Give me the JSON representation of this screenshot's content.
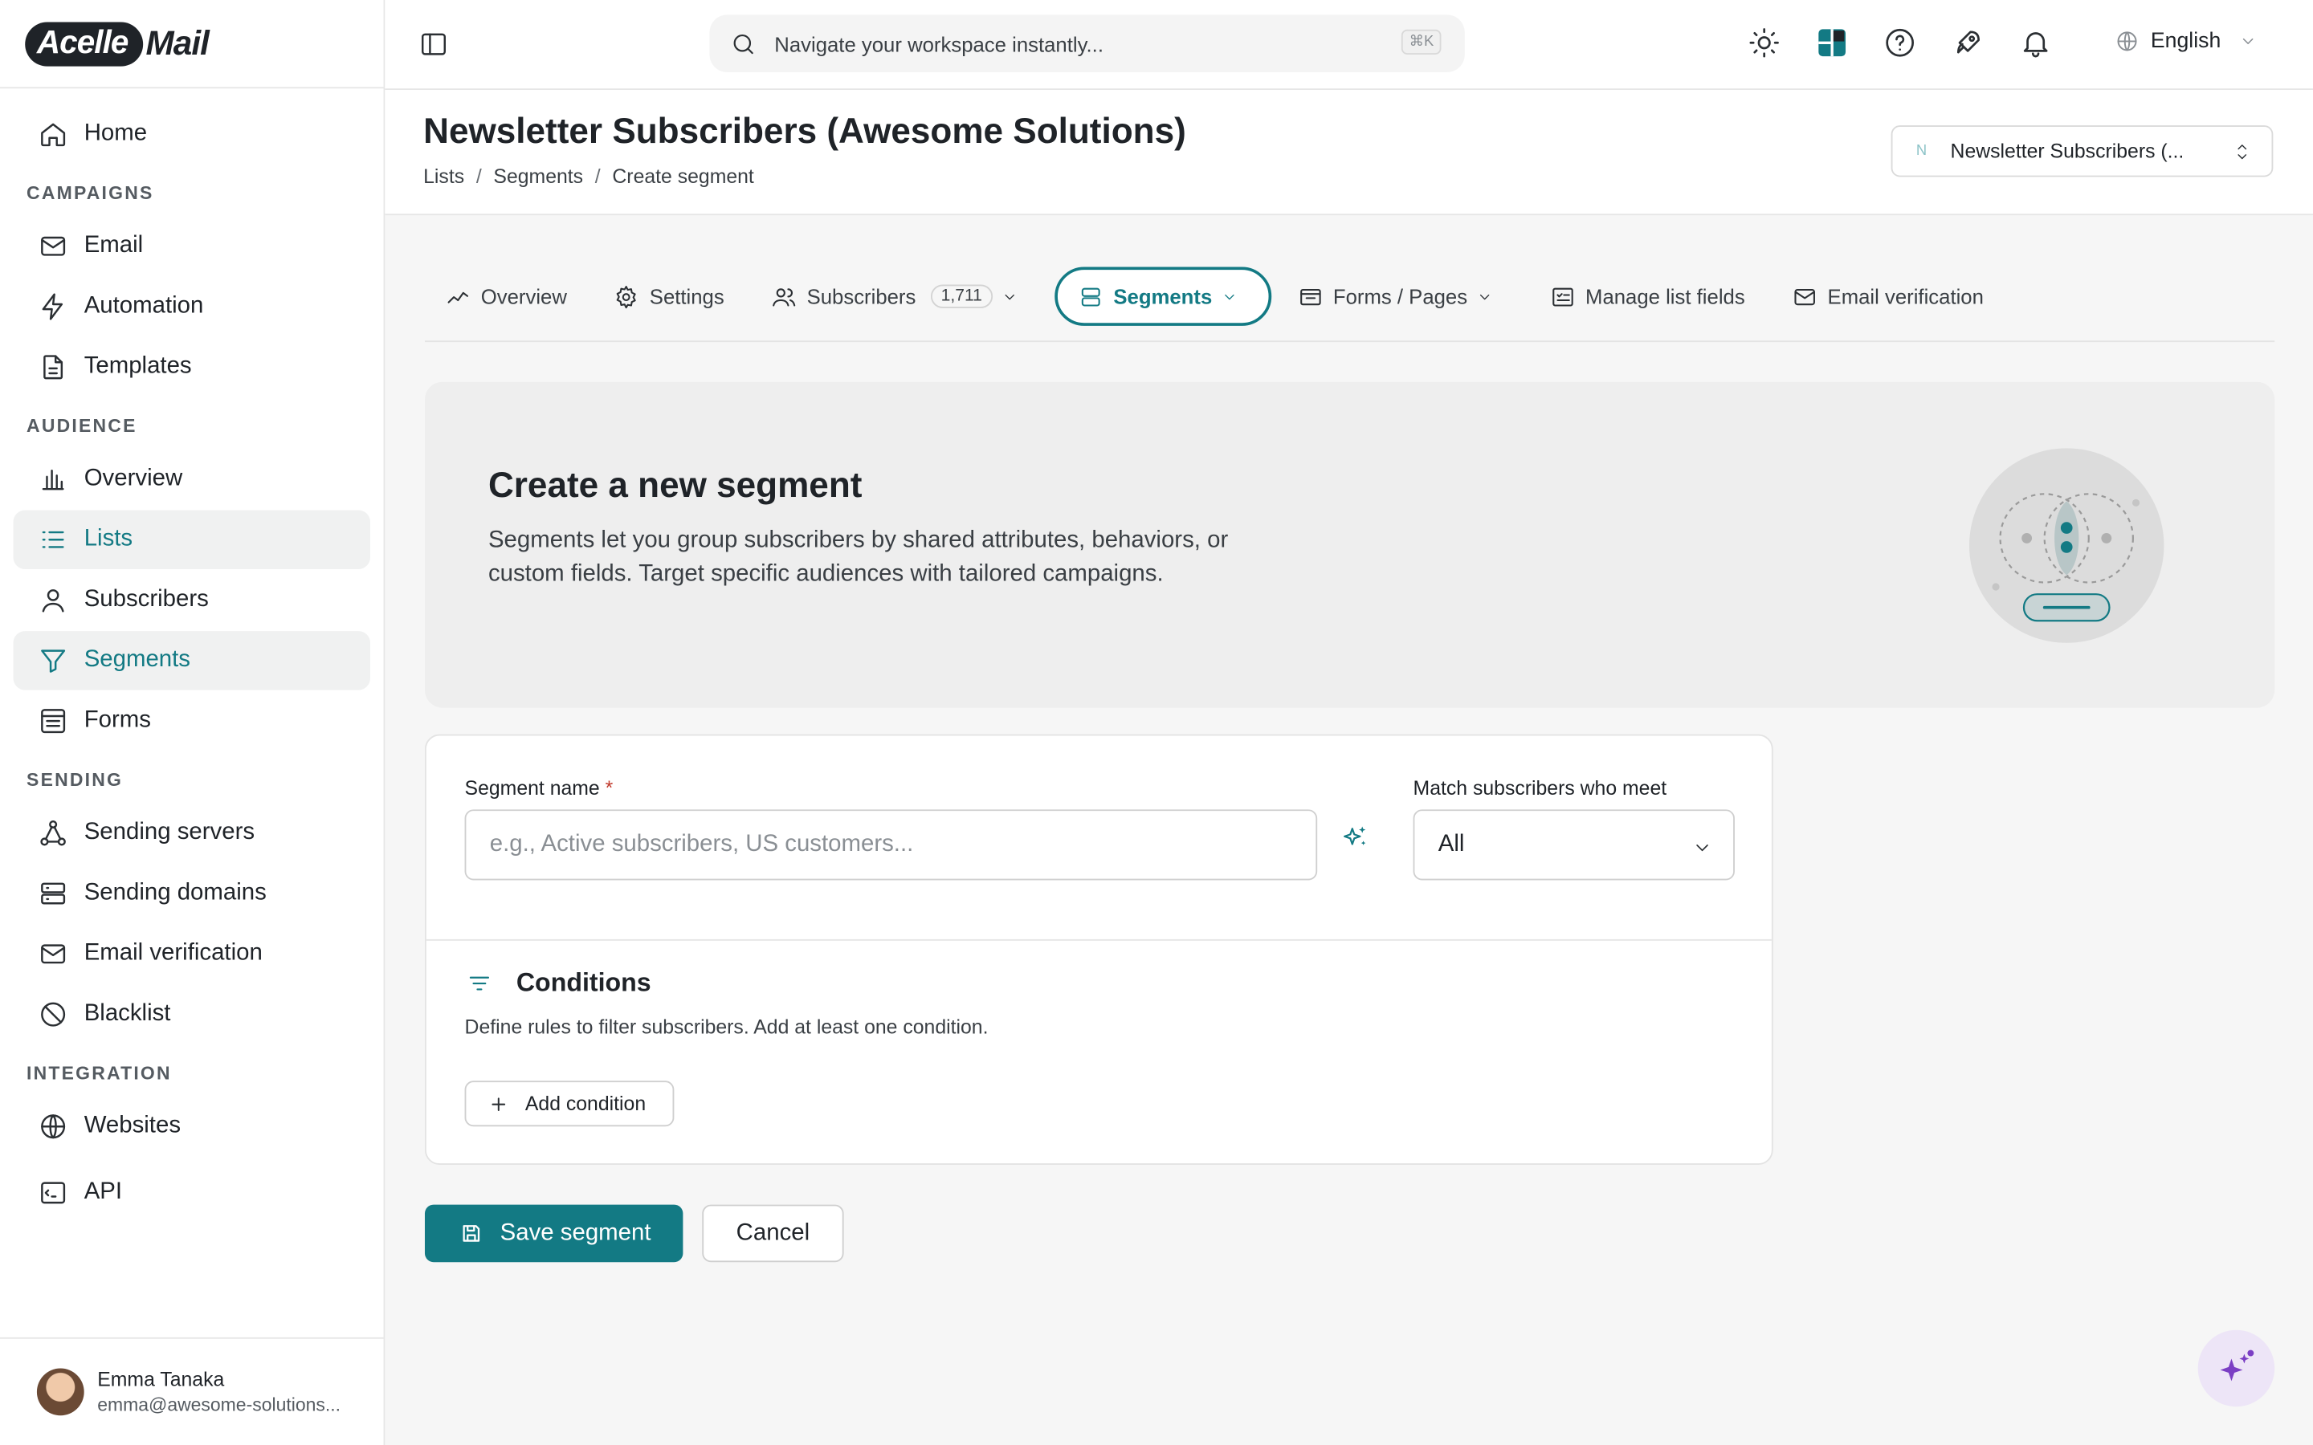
{
  "brand": {
    "logo_part1": "Acelle",
    "logo_part2": "Mail"
  },
  "sidebar": {
    "items_top": [
      {
        "label": "Home",
        "icon": "home-icon"
      }
    ],
    "sections": [
      {
        "title": "CAMPAIGNS",
        "items": [
          {
            "label": "Email",
            "icon": "mail-icon"
          },
          {
            "label": "Automation",
            "icon": "bolt-icon"
          },
          {
            "label": "Templates",
            "icon": "file-icon"
          }
        ]
      },
      {
        "title": "AUDIENCE",
        "items": [
          {
            "label": "Overview",
            "icon": "bar-chart-icon"
          },
          {
            "label": "Lists",
            "icon": "list-icon",
            "active": true
          },
          {
            "label": "Subscribers",
            "icon": "user-icon"
          },
          {
            "label": "Segments",
            "icon": "filter-icon",
            "active": true
          },
          {
            "label": "Forms",
            "icon": "form-icon"
          }
        ]
      },
      {
        "title": "SENDING",
        "items": [
          {
            "label": "Sending servers",
            "icon": "network-icon"
          },
          {
            "label": "Sending domains",
            "icon": "server-icon"
          },
          {
            "label": "Email verification",
            "icon": "mail-check-icon"
          },
          {
            "label": "Blacklist",
            "icon": "ban-icon"
          }
        ]
      },
      {
        "title": "INTEGRATION",
        "items": [
          {
            "label": "Websites",
            "icon": "globe-icon"
          },
          {
            "label": "API",
            "icon": "terminal-icon"
          }
        ]
      }
    ],
    "user": {
      "name": "Emma Tanaka",
      "email": "emma@awesome-solutions..."
    }
  },
  "topbar": {
    "search_placeholder": "Navigate your workspace instantly...",
    "search_shortcut": "⌘K",
    "language": "English"
  },
  "header": {
    "title": "Newsletter Subscribers (Awesome Solutions)",
    "breadcrumb": [
      "Lists",
      "Segments",
      "Create segment"
    ],
    "list_select": {
      "initial": "N",
      "value": "Newsletter Subscribers (..."
    }
  },
  "tabs": [
    {
      "label": "Overview",
      "icon": "sparkline-icon"
    },
    {
      "label": "Settings",
      "icon": "gear-icon"
    },
    {
      "label": "Subscribers",
      "icon": "users-icon",
      "badge": "1,711",
      "dropdown": true
    },
    {
      "label": "Segments",
      "icon": "stack-icon",
      "dropdown": true,
      "active": true
    },
    {
      "label": "Forms / Pages",
      "icon": "window-icon",
      "dropdown": true
    },
    {
      "label": "Manage list fields",
      "icon": "fields-icon"
    },
    {
      "label": "Email verification",
      "icon": "mail-check-icon"
    }
  ],
  "hero": {
    "title": "Create a new segment",
    "description": "Segments let you group subscribers by shared attributes, behaviors, or custom fields. Target specific audiences with tailored campaigns."
  },
  "form": {
    "segment_name_label": "Segment name",
    "required_mark": "*",
    "segment_name_placeholder": "e.g., Active subscribers, US customers...",
    "segment_name_value": "",
    "match_label": "Match subscribers who meet",
    "match_value": "All",
    "conditions_title": "Conditions",
    "conditions_desc": "Define rules to filter subscribers. Add at least one condition.",
    "add_condition_label": "Add condition"
  },
  "actions": {
    "save_label": "Save segment",
    "cancel_label": "Cancel"
  },
  "colors": {
    "accent": "#137a84",
    "text": "#1f2328",
    "background": "#f6f6f6",
    "assistant": "#7b3fc4"
  }
}
